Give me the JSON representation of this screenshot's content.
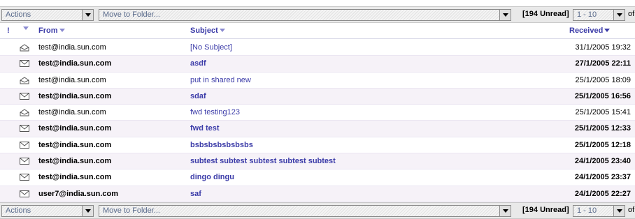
{
  "toolbar": {
    "actions_label": "Actions",
    "move_label": "Move to Folder...",
    "unread_label": "[194 Unread]",
    "page_range": "1 - 10",
    "of_label": "of"
  },
  "columns": {
    "from": "From",
    "subject": "Subject",
    "received": "Received"
  },
  "messages": [
    {
      "from": "test@india.sun.com",
      "subject": "[No Subject]",
      "received": "31/1/2005 19:32",
      "read": true
    },
    {
      "from": "test@india.sun.com",
      "subject": "asdf",
      "received": "27/1/2005 22:11",
      "read": false
    },
    {
      "from": "test@india.sun.com",
      "subject": "put in shared new",
      "received": "25/1/2005 18:09",
      "read": true
    },
    {
      "from": "test@india.sun.com",
      "subject": "sdaf",
      "received": "25/1/2005 16:56",
      "read": false
    },
    {
      "from": "test@india.sun.com",
      "subject": "fwd testing123",
      "received": "25/1/2005 15:41",
      "read": true
    },
    {
      "from": "test@india.sun.com",
      "subject": "fwd test",
      "received": "25/1/2005 12:33",
      "read": false
    },
    {
      "from": "test@india.sun.com",
      "subject": "bsbsbsbsbsbsbs",
      "received": "25/1/2005 12:18",
      "read": false
    },
    {
      "from": "test@india.sun.com",
      "subject": "subtest subtest subtest subtest subtest",
      "received": "24/1/2005 23:40",
      "read": false
    },
    {
      "from": "test@india.sun.com",
      "subject": "dingo dingu",
      "received": "24/1/2005 23:37",
      "read": false
    },
    {
      "from": "user7@india.sun.com",
      "subject": "saf",
      "received": "24/1/2005 22:27",
      "read": false
    }
  ],
  "icons": {
    "important": "exclamation-icon",
    "read": "envelope-open-icon",
    "unread": "envelope-closed-icon"
  }
}
